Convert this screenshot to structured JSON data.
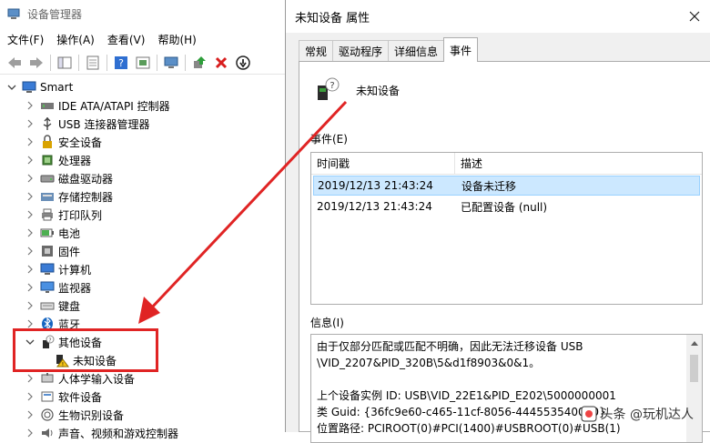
{
  "device_manager": {
    "title": "设备管理器",
    "menu": [
      "文件(F)",
      "操作(A)",
      "查看(V)",
      "帮助(H)"
    ],
    "root": "Smart",
    "tree": [
      {
        "label": "IDE ATA/ATAPI 控制器",
        "icon": "ide-icon"
      },
      {
        "label": "USB 连接器管理器",
        "icon": "usb-icon"
      },
      {
        "label": "安全设备",
        "icon": "security-device-icon"
      },
      {
        "label": "处理器",
        "icon": "processor-icon"
      },
      {
        "label": "磁盘驱动器",
        "icon": "disk-drive-icon"
      },
      {
        "label": "存储控制器",
        "icon": "storage-controller-icon"
      },
      {
        "label": "打印队列",
        "icon": "printer-icon"
      },
      {
        "label": "电池",
        "icon": "battery-icon"
      },
      {
        "label": "固件",
        "icon": "firmware-icon"
      },
      {
        "label": "计算机",
        "icon": "computer-icon"
      },
      {
        "label": "监视器",
        "icon": "monitor-icon"
      },
      {
        "label": "键盘",
        "icon": "keyboard-icon"
      },
      {
        "label": "蓝牙",
        "icon": "bluetooth-icon"
      },
      {
        "label": "其他设备",
        "icon": "other-devices-icon",
        "expanded": true
      },
      {
        "label": "未知设备",
        "icon": "unknown-device-warning-icon",
        "child": true
      },
      {
        "label": "人体学输入设备",
        "icon": "hid-icon"
      },
      {
        "label": "软件设备",
        "icon": "software-device-icon"
      },
      {
        "label": "生物识别设备",
        "icon": "biometric-icon"
      },
      {
        "label": "声音、视频和游戏控制器",
        "icon": "sound-icon"
      }
    ]
  },
  "dialog": {
    "title": "未知设备 属性",
    "tabs": [
      "常规",
      "驱动程序",
      "详细信息",
      "事件"
    ],
    "active_tab": "事件",
    "device_name": "未知设备",
    "events_label": "事件(E)",
    "columns": [
      "时间戳",
      "描述"
    ],
    "events": [
      {
        "time": "2019/12/13 21:43:24",
        "desc": "设备未迁移",
        "selected": true
      },
      {
        "time": "2019/12/13 21:43:24",
        "desc": "已配置设备 (null)",
        "selected": false
      }
    ],
    "info_label": "信息(I)",
    "info_lines": [
      "由于仅部分匹配或匹配不明确，因此无法迁移设备 USB",
      "\\VID_2207&PID_320B\\5&d1f8903&0&1。",
      "",
      "上个设备实例 ID: USB\\VID_22E1&PID_E202\\5000000001",
      "类 Guid: {36fc9e60-c465-11cf-8056-444553540000}",
      "位置路径: PCIROOT(0)#PCI(1400)#USBROOT(0)#USB(1)"
    ]
  },
  "watermark": "头条 @玩机达人",
  "colors": {
    "highlight": "#e02424",
    "selection": "#cce8ff"
  }
}
